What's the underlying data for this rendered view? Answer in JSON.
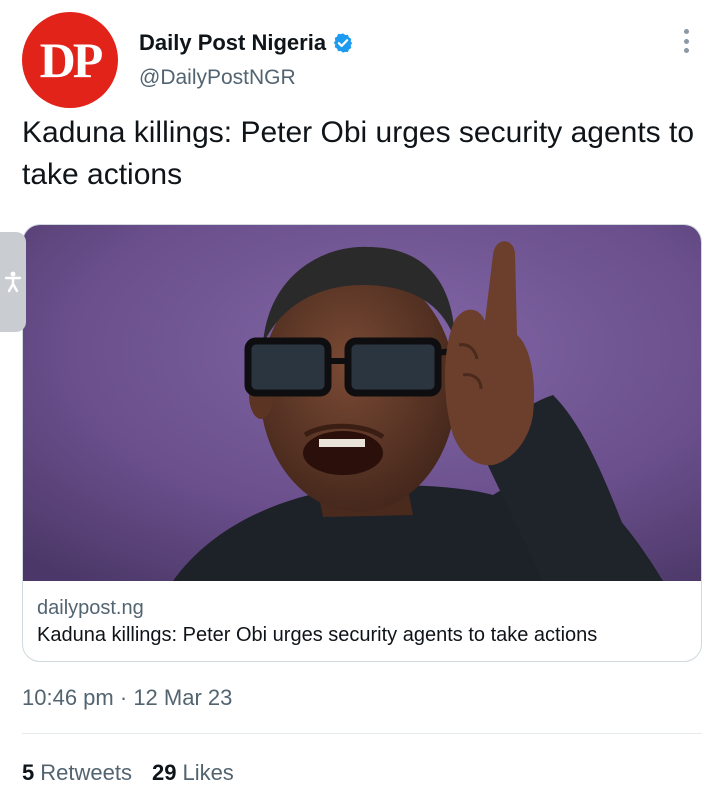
{
  "author": {
    "avatar_text": "DP",
    "display_name": "Daily Post Nigeria",
    "handle": "@DailyPostNGR",
    "verified": true
  },
  "tweet": {
    "text": "Kaduna killings: Peter Obi urges security agents to take actions"
  },
  "link_card": {
    "domain": "dailypost.ng",
    "title": "Kaduna killings: Peter Obi urges security agents to take actions"
  },
  "meta": {
    "time": "10:46 pm",
    "separator": "·",
    "date": "12 Mar 23"
  },
  "stats": {
    "retweets_count": "5",
    "retweets_label": "Retweets",
    "likes_count": "29",
    "likes_label": "Likes"
  },
  "icons": {
    "verified": "verified-badge-icon",
    "more": "more-options-icon",
    "accessibility": "accessibility-icon"
  },
  "colors": {
    "avatar_red": "#e2231a",
    "verified_blue": "#1d9bf0",
    "secondary_text": "#536471",
    "image_background": "#6a4f8c"
  }
}
